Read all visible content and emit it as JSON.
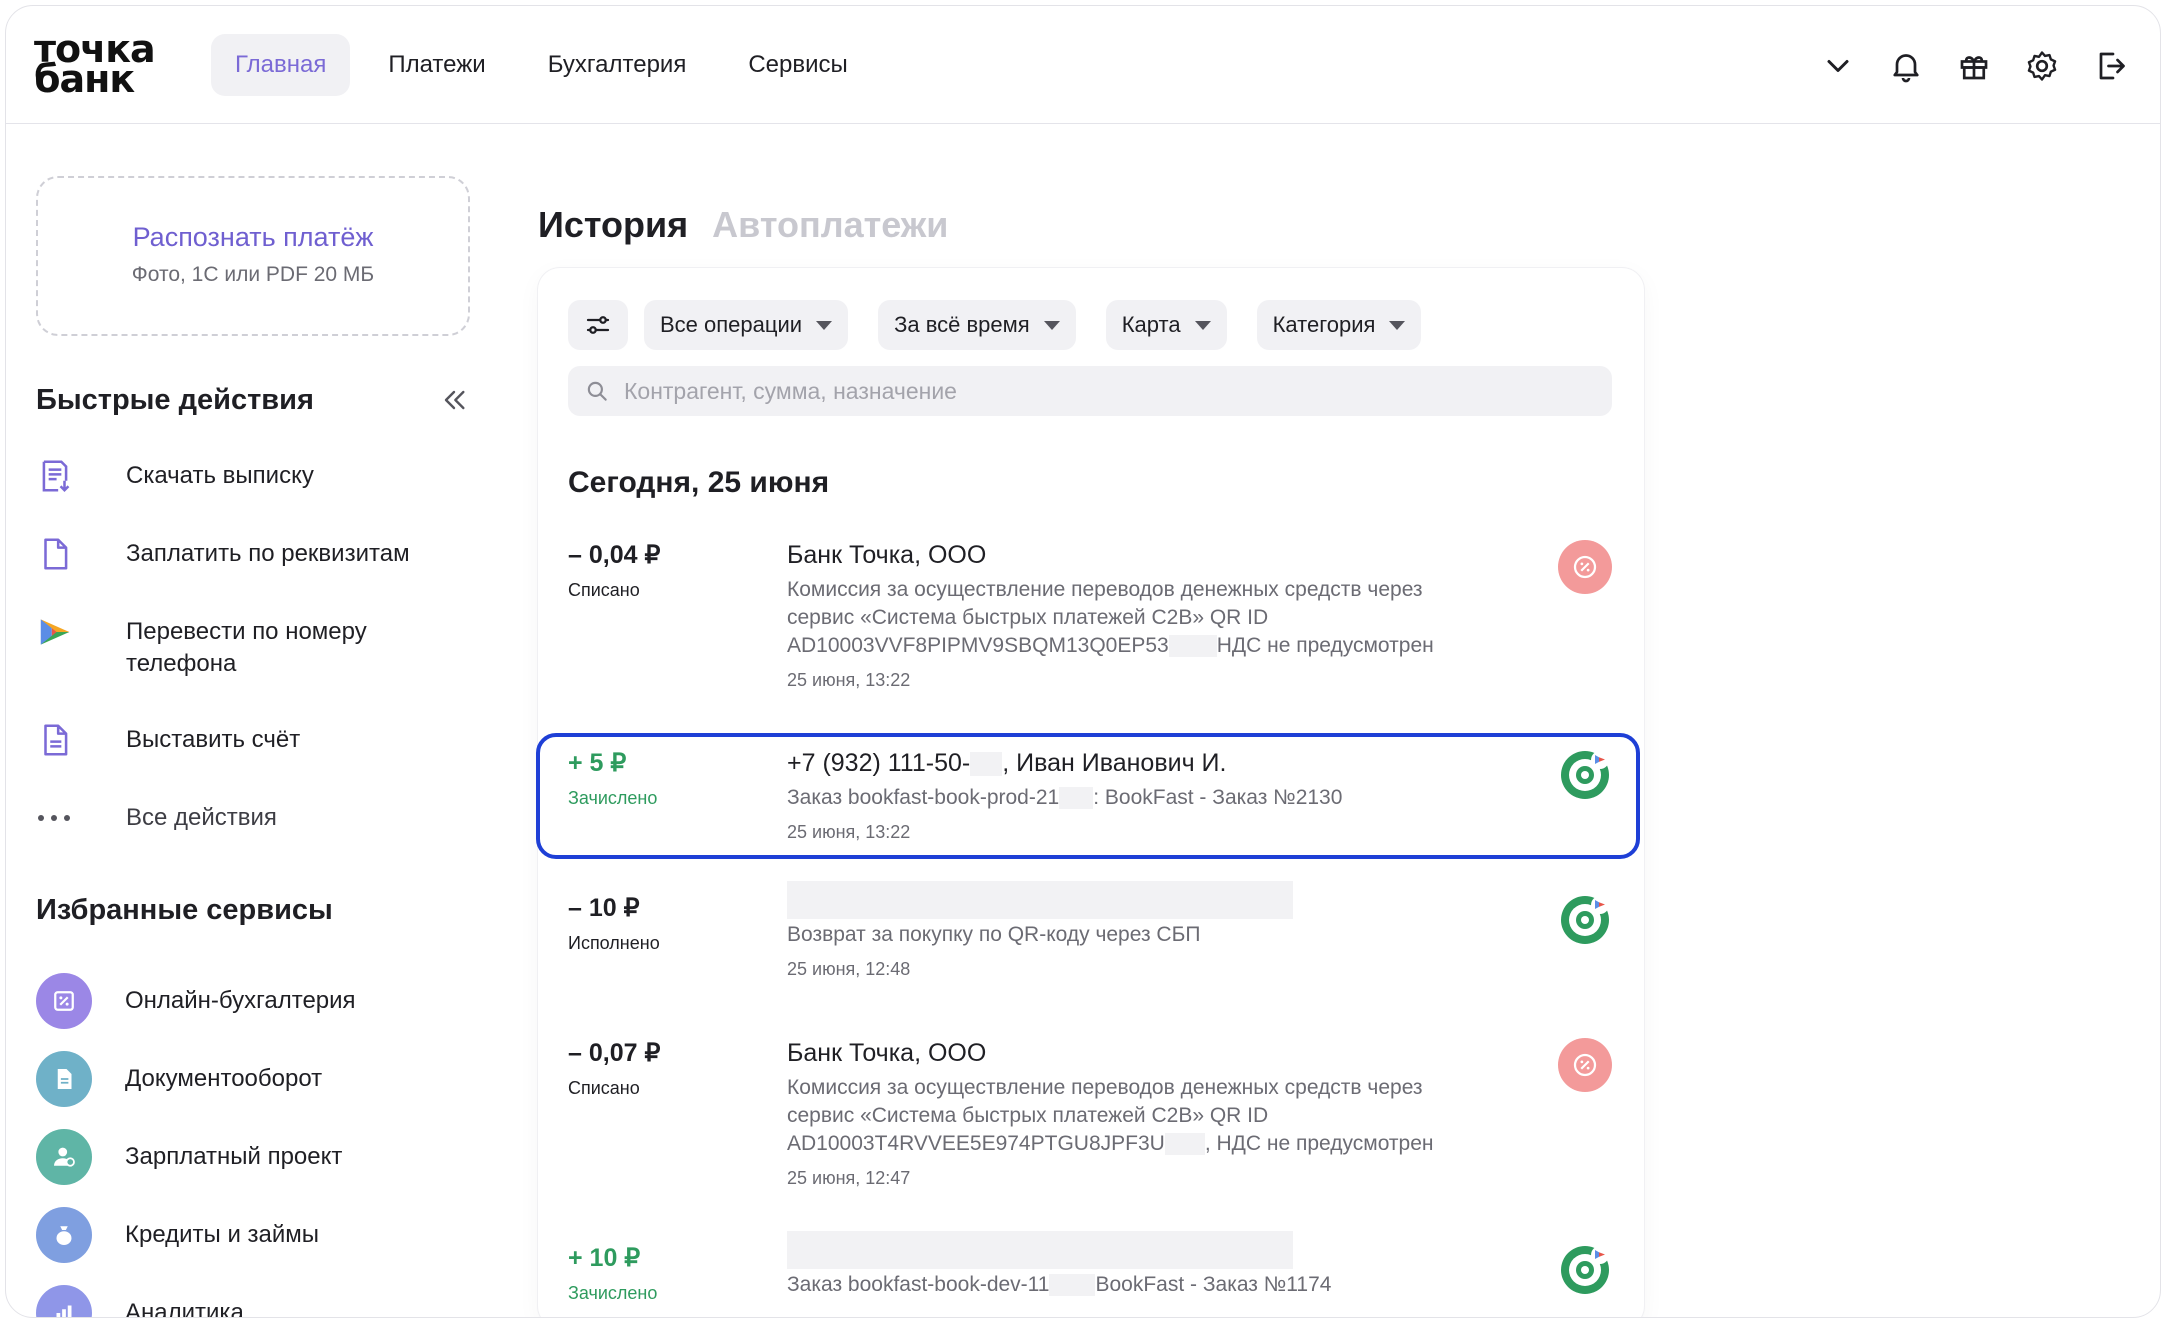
{
  "header": {
    "logo_line1": "точка",
    "logo_line2": "банк",
    "nav": [
      {
        "label": "Главная",
        "active": true
      },
      {
        "label": "Платежи",
        "active": false
      },
      {
        "label": "Бухгалтерия",
        "active": false
      },
      {
        "label": "Сервисы",
        "active": false
      }
    ],
    "icons": [
      "chevron-down-icon",
      "bell-icon",
      "gift-icon",
      "gear-icon",
      "logout-icon"
    ]
  },
  "sidebar": {
    "recognize": {
      "title": "Распознать платёж",
      "subtitle": "Фото, 1С или PDF 20 МБ"
    },
    "quick_actions_title": "Быстрые действия",
    "quick_actions": [
      {
        "label": "Скачать выписку",
        "icon": "statement-download-icon"
      },
      {
        "label": "Заплатить по реквизитам",
        "icon": "document-icon"
      },
      {
        "label": "Перевести по номеру телефона",
        "icon": "sbp-icon"
      },
      {
        "label": "Выставить счёт",
        "icon": "invoice-icon"
      },
      {
        "label": "Все действия",
        "icon": "more-dots-icon"
      }
    ],
    "favorites_title": "Избранные сервисы",
    "favorites": [
      {
        "label": "Онлайн-бухгалтерия",
        "icon": "percent-doc-icon",
        "color": "#9b87e6"
      },
      {
        "label": "Документооборот",
        "icon": "document-icon",
        "color": "#6fb1c8"
      },
      {
        "label": "Зарплатный проект",
        "icon": "person-icon",
        "color": "#5fb5a6"
      },
      {
        "label": "Кредиты и займы",
        "icon": "moneybag-icon",
        "color": "#7f9fe0"
      },
      {
        "label": "Аналитика",
        "icon": "bar-chart-icon",
        "color": "#8f96e8"
      }
    ]
  },
  "main": {
    "tabs": [
      {
        "label": "История",
        "active": true
      },
      {
        "label": "Автоплатежи",
        "active": false
      }
    ],
    "filters": [
      "Все операции",
      "За всё время",
      "Карта",
      "Категория"
    ],
    "search_placeholder": "Контрагент, сумма, назначение",
    "day_title": "Сегодня, 25 июня",
    "transactions": [
      {
        "amount": "– 0,04 ₽",
        "status": "Списано",
        "counterparty": "Банк Точка, ООО",
        "desc1": "Комиссия за осуществление переводов денежных средств через",
        "desc2": "сервис «Система быстрых платежей C2B» QR ID",
        "desc3a": "AD10003VVF8PIPMV9SBQM13Q0EP53",
        "desc3b": "НДС не предусмотрен",
        "time": "25 июня, 13:22",
        "badge": "percent-badge-icon"
      },
      {
        "amount": "+ 5 ₽",
        "status": "Зачислено",
        "counterparty_a": "+7 (932) 111-50-",
        "counterparty_b": ", Иван Иванович И.",
        "desc_a": "Заказ bookfast-book-prod-21",
        "desc_b": ": BookFast - Заказ №2130",
        "time": "25 июня, 13:22",
        "badge": "sbp-badge-icon"
      },
      {
        "amount": "– 10 ₽",
        "status": "Исполнено",
        "desc": "Возврат за покупку по QR-коду через СБП",
        "time": "25 июня, 12:48",
        "badge": "sbp-badge-icon"
      },
      {
        "amount": "– 0,07 ₽",
        "status": "Списано",
        "counterparty": "Банк Точка, ООО",
        "desc1": "Комиссия за осуществление переводов денежных средств через",
        "desc2": "сервис «Система быстрых платежей C2B» QR ID",
        "desc3a": "AD10003T4RVVEE5E974PTGU8JPF3U",
        "desc3b": ", НДС не предусмотрен",
        "time": "25 июня, 12:47",
        "badge": "percent-badge-icon"
      },
      {
        "amount": "+ 10 ₽",
        "status": "Зачислено",
        "desc_a": "Заказ bookfast-book-dev-11",
        "desc_b": "BookFast - Заказ №1174",
        "badge": "sbp-badge-icon"
      }
    ]
  },
  "colors": {
    "accent": "#7b6ad6",
    "credit": "#2e9b5e",
    "highlight": "#1e3fd6",
    "percent_badge": "#f39a9a"
  }
}
